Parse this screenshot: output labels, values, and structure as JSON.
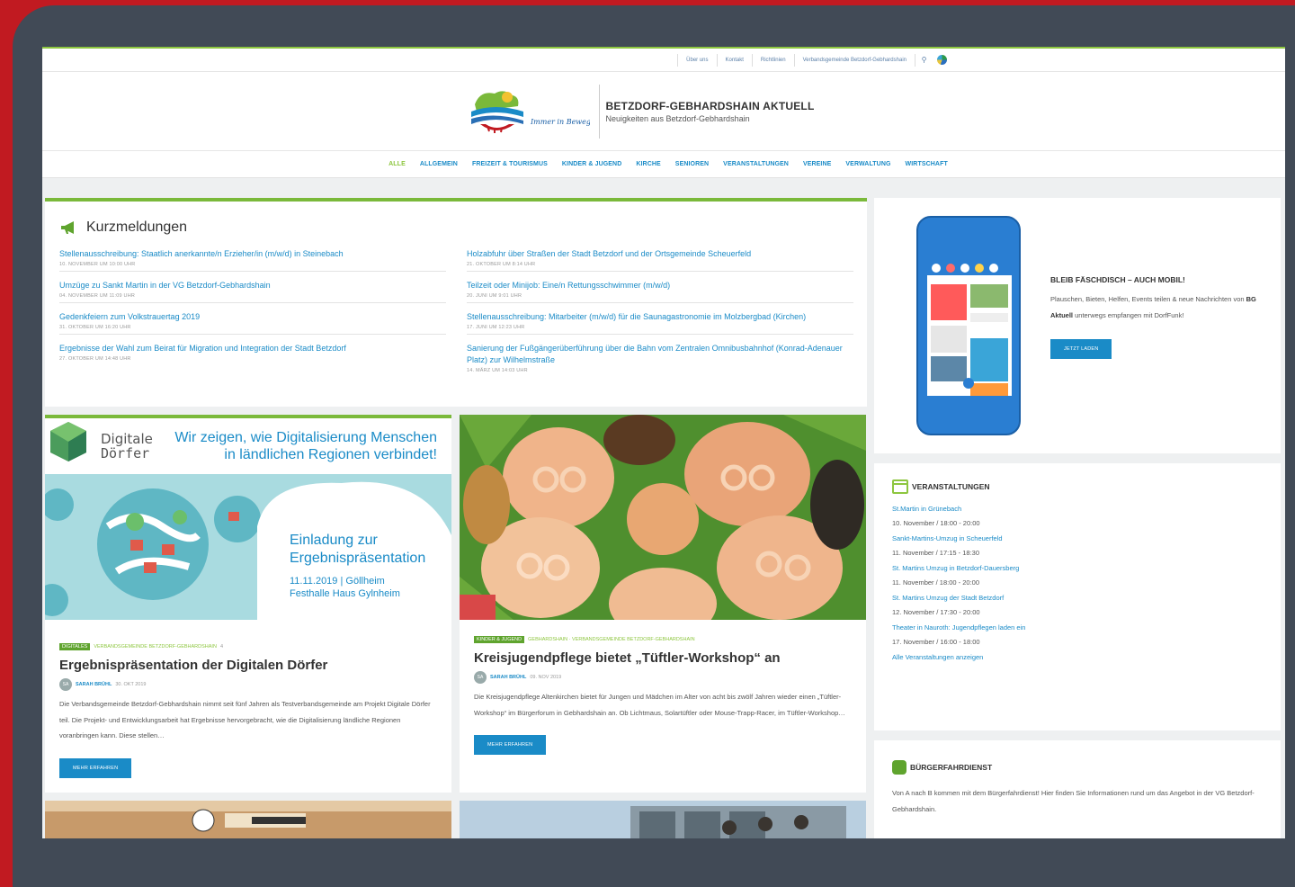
{
  "topbar": {
    "links": [
      "Über uns",
      "Kontakt",
      "Richtlinien",
      "Verbandsgemeinde Betzdorf-Gebhardshain"
    ]
  },
  "header": {
    "logo_slogan": "Immer in Bewegung",
    "title": "BETZDORF-GEBHARDSHAIN AKTUELL",
    "subtitle": "Neuigkeiten aus Betzdorf-Gebhardshain"
  },
  "nav": [
    "ALLE",
    "ALLGEMEIN",
    "FREIZEIT & TOURISMUS",
    "KINDER & JUGEND",
    "KIRCHE",
    "SENIOREN",
    "VERANSTALTUNGEN",
    "VEREINE",
    "VERWALTUNG",
    "WIRTSCHAFT"
  ],
  "kurz": {
    "title": "Kurzmeldungen",
    "left": [
      {
        "title": "Stellenausschreibung: Staatlich anerkannte/n Erzieher/in (m/w/d) in Steinebach",
        "date": "10. NOVEMBER UM 10:00 UHR"
      },
      {
        "title": "Umzüge zu Sankt Martin in der VG Betzdorf-Gebhardshain",
        "date": "04. NOVEMBER UM 11:09 UHR"
      },
      {
        "title": "Gedenkfeiern zum Volkstrauertag 2019",
        "date": "31. OKTOBER UM 16:20 UHR"
      },
      {
        "title": "Ergebnisse der Wahl zum Beirat für Migration und Integration der Stadt Betzdorf",
        "date": "27. OKTOBER UM 14:48 UHR"
      }
    ],
    "right": [
      {
        "title": "Holzabfuhr über Straßen der Stadt Betzdorf und der Ortsgemeinde Scheuerfeld",
        "date": "21. OKTOBER UM 8:14 UHR"
      },
      {
        "title": "Teilzeit oder Minijob: Eine/n Rettungsschwimmer (m/w/d)",
        "date": "20. JUNI UM 9:01 UHR"
      },
      {
        "title": "Stellenausschreibung: Mitarbeiter (m/w/d) für die Saunagastronomie im Molzbergbad (Kirchen)",
        "date": "17. JUNI UM 12:23 UHR"
      },
      {
        "title": "Sanierung der Fußgängerüberführung über die Bahn vom Zentralen Omnibusbahnhof (Konrad-Adenauer Platz) zur Wilhelmstraße",
        "date": "14. MÄRZ UM 14:03 UHR"
      }
    ]
  },
  "article1": {
    "banner_brand_1": "Digitale",
    "banner_brand_2": "Dörfer",
    "banner_headline_1": "Wir zeigen, wie Digitalisierung Menschen",
    "banner_headline_2": "in ländlichen Regionen verbindet!",
    "banner_invite_1": "Einladung zur",
    "banner_invite_2": "Ergebnispräsentation",
    "banner_date": "11.11.2019 | Göllheim",
    "banner_place": "Festhalle Haus Gylnheim",
    "tag": "DIGITALES",
    "category": "VERBANDSGEMEINDE BETZDORF-GEBHARDSHAIN",
    "comments": "4",
    "title": "Ergebnispräsentation der Digitalen Dörfer",
    "avatar": "SA",
    "author": "SARAH BRÜHL",
    "date": "30. OKT 2019",
    "excerpt": "Die Verbandsgemeinde Betzdorf-Gebhardshain nimmt seit fünf Jahren als Testverbandsgemeinde am Projekt Digitale Dörfer teil. Die Projekt- und Entwicklungsarbeit hat Ergebnisse hervorgebracht, wie die Digitalisierung ländliche Regionen voranbringen kann. Diese stellen…",
    "button": "MEHR ERFAHREN"
  },
  "article2": {
    "tag": "KINDER & JUGEND",
    "category": "GEBHARDSHAIN · VERBANDSGEMEINDE BETZDORF-GEBHARDSHAIN",
    "title": "Kreisjugendpflege bietet „Tüftler-Workshop“ an",
    "avatar": "SA",
    "author": "SARAH BRÜHL",
    "date": "09. NOV 2019",
    "excerpt": "Die Kreisjugendpflege Altenkirchen bietet für Jungen und Mädchen im Alter von acht bis zwölf Jahren wieder einen „Tüftler-Workshop“ im Bürgerforum in Gebhardshain an. Ob Lichtmaus, Solartüftler oder Mouse-Trapp-Racer, im Tüftler-Workshop…",
    "button": "MEHR ERFAHREN"
  },
  "app": {
    "title": "BLEIB FÄSCHDISCH – AUCH MOBIL!",
    "text_1": "Plauschen, Bieten, Helfen, Events teilen & neue Nachrichten von ",
    "text_bold": "BG Aktuell",
    "text_2": " unterwegs empfangen mit DorfFunk!",
    "button": "JETZT LADEN"
  },
  "events": {
    "title": "VERANSTALTUNGEN",
    "items": [
      {
        "title": "St.Martin in Grünebach",
        "date": "10. November / 18:00 - 20:00"
      },
      {
        "title": "Sankt-Martins-Umzug in Scheuerfeld",
        "date": "11. November / 17:15 - 18:30"
      },
      {
        "title": "St. Martins Umzug in Betzdorf-Dauersberg",
        "date": "11. November / 18:00 - 20:00"
      },
      {
        "title": "St. Martins Umzug der Stadt Betzdorf",
        "date": "12. November / 17:30 - 20:00"
      },
      {
        "title": "Theater in Nauroth: Jugendpflegen laden ein",
        "date": "17. November / 16:00 - 18:00"
      }
    ],
    "all_link": "Alle Veranstaltungen anzeigen"
  },
  "bus": {
    "title": "BÜRGERFAHRDIENST",
    "text": "Von A nach B kommen mit dem Bürgerfahrdienst! Hier finden Sie Informationen rund um das Angebot in der VG Betzdorf-Gebhardshain."
  }
}
